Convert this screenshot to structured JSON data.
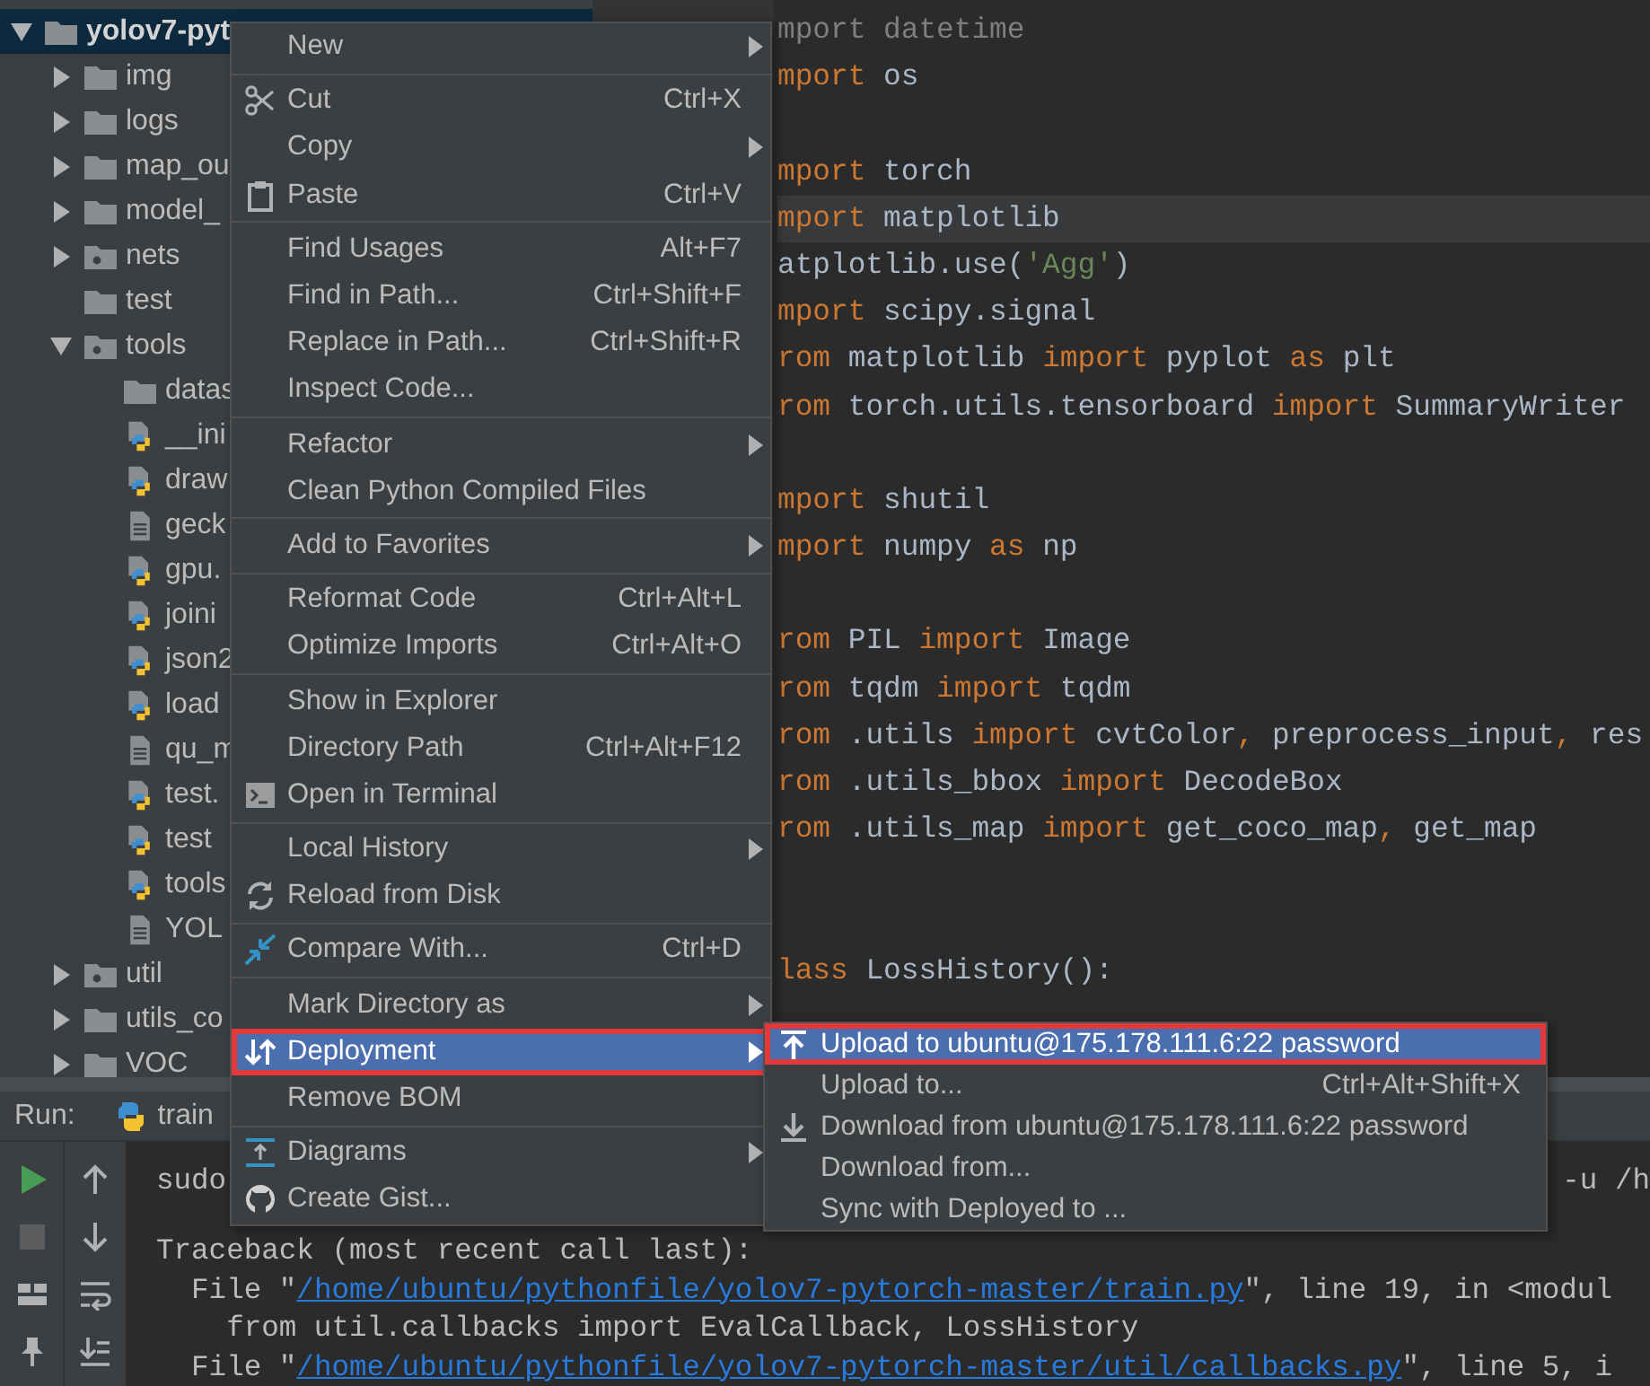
{
  "project_tree": {
    "nodes": [
      {
        "label": "yolov7-pyt",
        "kind": "folder",
        "expanded": true,
        "selected": true,
        "children": [
          {
            "label": "img",
            "kind": "folder",
            "expanded": false,
            "selected": false
          },
          {
            "label": "logs",
            "kind": "folder",
            "expanded": false,
            "selected": false
          },
          {
            "label": "map_ou",
            "kind": "folder",
            "expanded": false,
            "selected": false
          },
          {
            "label": "model_",
            "kind": "folder",
            "expanded": false,
            "selected": false
          },
          {
            "label": "nets",
            "kind": "package",
            "expanded": false,
            "selected": false
          },
          {
            "label": "test",
            "kind": "folder",
            "selected": false
          },
          {
            "label": "tools",
            "kind": "package",
            "expanded": true,
            "selected": false,
            "children": [
              {
                "label": "datas",
                "kind": "folder",
                "selected": false
              },
              {
                "label": "__ini",
                "kind": "python",
                "selected": false
              },
              {
                "label": "draw",
                "kind": "python",
                "selected": false
              },
              {
                "label": "geck",
                "kind": "text",
                "selected": false
              },
              {
                "label": "gpu.",
                "kind": "python",
                "selected": false
              },
              {
                "label": "joini",
                "kind": "python",
                "selected": false
              },
              {
                "label": "json2",
                "kind": "python",
                "selected": false
              },
              {
                "label": "load",
                "kind": "python",
                "selected": false
              },
              {
                "label": "qu_m",
                "kind": "text",
                "selected": false
              },
              {
                "label": "test.",
                "kind": "python",
                "selected": false
              },
              {
                "label": "test",
                "kind": "python",
                "selected": false
              },
              {
                "label": "tools",
                "kind": "python",
                "selected": false
              },
              {
                "label": "YOL",
                "kind": "text",
                "selected": false
              }
            ]
          },
          {
            "label": "util",
            "kind": "package",
            "expanded": false,
            "selected": false
          },
          {
            "label": "utils_co",
            "kind": "folder",
            "expanded": false,
            "selected": false
          },
          {
            "label": "VOC",
            "kind": "folder",
            "expanded": false,
            "selected": false
          }
        ]
      }
    ]
  },
  "editor": {
    "lines": [
      {
        "current": false,
        "tokens": [
          {
            "text": "mport datetime",
            "kind": "unused"
          }
        ]
      },
      {
        "current": false,
        "tokens": [
          {
            "text": "mport",
            "kind": "keyword"
          },
          {
            "text": " os",
            "kind": "plain"
          }
        ]
      },
      {
        "current": false
      },
      {
        "current": false,
        "tokens": [
          {
            "text": "mport",
            "kind": "keyword"
          },
          {
            "text": " torch",
            "kind": "plain"
          }
        ]
      },
      {
        "current": true,
        "tokens": [
          {
            "text": "mport",
            "kind": "keyword"
          },
          {
            "text": " matplotlib",
            "kind": "plain"
          }
        ]
      },
      {
        "current": false,
        "tokens": [
          {
            "text": "atplotlib.use(",
            "kind": "plain"
          },
          {
            "text": "'Agg'",
            "kind": "string"
          },
          {
            "text": ")",
            "kind": "plain"
          }
        ]
      },
      {
        "current": false,
        "tokens": [
          {
            "text": "mport",
            "kind": "keyword"
          },
          {
            "text": " scipy.signal",
            "kind": "plain"
          }
        ]
      },
      {
        "current": false,
        "tokens": [
          {
            "text": "rom",
            "kind": "keyword"
          },
          {
            "text": " matplotlib ",
            "kind": "plain"
          },
          {
            "text": "import",
            "kind": "keyword"
          },
          {
            "text": " pyplot ",
            "kind": "plain"
          },
          {
            "text": "as",
            "kind": "keyword"
          },
          {
            "text": " plt",
            "kind": "plain"
          }
        ]
      },
      {
        "current": false,
        "tokens": [
          {
            "text": "rom",
            "kind": "keyword"
          },
          {
            "text": " torch.utils.tensorboard ",
            "kind": "plain"
          },
          {
            "text": "import",
            "kind": "keyword"
          },
          {
            "text": " SummaryWriter",
            "kind": "plain"
          }
        ]
      },
      {
        "current": false
      },
      {
        "current": false,
        "tokens": [
          {
            "text": "mport",
            "kind": "keyword"
          },
          {
            "text": " shutil",
            "kind": "plain"
          }
        ]
      },
      {
        "current": false,
        "tokens": [
          {
            "text": "mport",
            "kind": "keyword"
          },
          {
            "text": " numpy ",
            "kind": "plain"
          },
          {
            "text": "as",
            "kind": "keyword"
          },
          {
            "text": " np",
            "kind": "plain"
          }
        ]
      },
      {
        "current": false
      },
      {
        "current": false,
        "tokens": [
          {
            "text": "rom",
            "kind": "keyword"
          },
          {
            "text": " PIL ",
            "kind": "plain"
          },
          {
            "text": "import",
            "kind": "keyword"
          },
          {
            "text": " Image",
            "kind": "plain"
          }
        ]
      },
      {
        "current": false,
        "tokens": [
          {
            "text": "rom",
            "kind": "keyword"
          },
          {
            "text": " tqdm ",
            "kind": "plain"
          },
          {
            "text": "import",
            "kind": "keyword"
          },
          {
            "text": " tqdm",
            "kind": "plain"
          }
        ]
      },
      {
        "current": false,
        "tokens": [
          {
            "text": "rom",
            "kind": "keyword"
          },
          {
            "text": " .utils ",
            "kind": "plain"
          },
          {
            "text": "import",
            "kind": "keyword"
          },
          {
            "text": " cvtColor",
            "kind": "plain"
          },
          {
            "text": ",",
            "kind": "keyword"
          },
          {
            "text": " preprocess_input",
            "kind": "plain"
          },
          {
            "text": ",",
            "kind": "keyword"
          },
          {
            "text": " res",
            "kind": "plain"
          }
        ]
      },
      {
        "current": false,
        "tokens": [
          {
            "text": "rom",
            "kind": "keyword"
          },
          {
            "text": " .utils_bbox ",
            "kind": "plain"
          },
          {
            "text": "import",
            "kind": "keyword"
          },
          {
            "text": " DecodeBox",
            "kind": "plain"
          }
        ]
      },
      {
        "current": false,
        "tokens": [
          {
            "text": "rom",
            "kind": "keyword"
          },
          {
            "text": " .utils_map ",
            "kind": "plain"
          },
          {
            "text": "import",
            "kind": "keyword"
          },
          {
            "text": " get_coco_map",
            "kind": "plain"
          },
          {
            "text": ",",
            "kind": "keyword"
          },
          {
            "text": " get_map",
            "kind": "plain"
          }
        ]
      },
      {
        "current": false
      },
      {
        "current": false
      },
      {
        "current": false,
        "tokens": [
          {
            "text": "lass",
            "kind": "keyword"
          },
          {
            "text": " LossHistory():",
            "kind": "plain"
          }
        ]
      }
    ]
  },
  "run_panel": {
    "label": "Run:",
    "tabs": [
      {
        "label": "train"
      }
    ],
    "console": [
      {
        "segments": [
          {
            "text": "sudo",
            "kind": "plain"
          },
          {
            "text": "-u /h",
            "kind": "right"
          }
        ]
      },
      {
        "segments": [
          {
            "text": "Traceback (most recent call last):",
            "kind": "plain"
          }
        ]
      },
      {
        "segments": [
          {
            "text": "  File \"",
            "kind": "plain"
          },
          {
            "text": "/home/ubuntu/pythonfile/yolov7-pytorch-master/train.py",
            "kind": "link"
          },
          {
            "text": "\", line 19, in <modul",
            "kind": "plain"
          }
        ]
      },
      {
        "segments": [
          {
            "text": "    from util.callbacks import EvalCallback, LossHistory",
            "kind": "plain"
          }
        ]
      },
      {
        "segments": [
          {
            "text": "  File \"",
            "kind": "plain"
          },
          {
            "text": "/home/ubuntu/pythonfile/yolov7-pytorch-master/util/callbacks.py",
            "kind": "link"
          },
          {
            "text": "\", line 5, i",
            "kind": "plain"
          }
        ]
      }
    ]
  },
  "context_menu": {
    "groups": [
      {
        "items": [
          {
            "label": "New",
            "submenu": true,
            "selected": false,
            "annotated": false
          }
        ]
      },
      {
        "items": [
          {
            "label": "Cut",
            "shortcut": "Ctrl+X",
            "kind": "cut",
            "submenu": false,
            "selected": false,
            "annotated": false
          },
          {
            "label": "Copy",
            "submenu": true,
            "selected": false,
            "annotated": false
          },
          {
            "label": "Paste",
            "shortcut": "Ctrl+V",
            "kind": "paste",
            "submenu": false,
            "selected": false,
            "annotated": false
          }
        ]
      },
      {
        "items": [
          {
            "label": "Find Usages",
            "shortcut": "Alt+F7",
            "submenu": false,
            "selected": false,
            "annotated": false
          },
          {
            "label": "Find in Path...",
            "shortcut": "Ctrl+Shift+F",
            "submenu": false,
            "selected": false,
            "annotated": false
          },
          {
            "label": "Replace in Path...",
            "shortcut": "Ctrl+Shift+R",
            "submenu": false,
            "selected": false,
            "annotated": false
          },
          {
            "label": "Inspect Code...",
            "submenu": false,
            "selected": false,
            "annotated": false
          }
        ]
      },
      {
        "items": [
          {
            "label": "Refactor",
            "submenu": true,
            "selected": false,
            "annotated": false
          },
          {
            "label": "Clean Python Compiled Files",
            "submenu": false,
            "selected": false,
            "annotated": false
          }
        ]
      },
      {
        "items": [
          {
            "label": "Add to Favorites",
            "submenu": true,
            "selected": false,
            "annotated": false
          }
        ]
      },
      {
        "items": [
          {
            "label": "Reformat Code",
            "shortcut": "Ctrl+Alt+L",
            "submenu": false,
            "selected": false,
            "annotated": false
          },
          {
            "label": "Optimize Imports",
            "shortcut": "Ctrl+Alt+O",
            "submenu": false,
            "selected": false,
            "annotated": false
          }
        ]
      },
      {
        "items": [
          {
            "label": "Show in Explorer",
            "submenu": false,
            "selected": false,
            "annotated": false
          },
          {
            "label": "Directory Path",
            "shortcut": "Ctrl+Alt+F12",
            "submenu": false,
            "selected": false,
            "annotated": false
          },
          {
            "label": "Open in Terminal",
            "kind": "terminal",
            "submenu": false,
            "selected": false,
            "annotated": false
          }
        ]
      },
      {
        "items": [
          {
            "label": "Local History",
            "submenu": true,
            "selected": false,
            "annotated": false
          },
          {
            "label": "Reload from Disk",
            "kind": "reload",
            "submenu": false,
            "selected": false,
            "annotated": false
          }
        ]
      },
      {
        "items": [
          {
            "label": "Compare With...",
            "shortcut": "Ctrl+D",
            "kind": "compare",
            "submenu": false,
            "selected": false,
            "annotated": false
          }
        ]
      },
      {
        "items": [
          {
            "label": "Mark Directory as",
            "submenu": true,
            "selected": false,
            "annotated": false
          },
          {
            "label": "Deployment",
            "kind": "deploy",
            "submenu": true,
            "selected": true,
            "annotated": true
          },
          {
            "label": "Remove BOM",
            "submenu": false,
            "selected": false,
            "annotated": false
          }
        ]
      },
      {
        "items": [
          {
            "label": "Diagrams",
            "kind": "diagram",
            "submenu": true,
            "selected": false,
            "annotated": false
          },
          {
            "label": "Create Gist...",
            "kind": "gist",
            "submenu": false,
            "selected": false,
            "annotated": false
          }
        ]
      }
    ]
  },
  "deployment_submenu": {
    "items": [
      {
        "label": "Upload to ubuntu@175.178.111.6:22 password",
        "kind": "upload",
        "selected": true,
        "annotated": true
      },
      {
        "label": "Upload to...",
        "shortcut": "Ctrl+Alt+Shift+X",
        "selected": false,
        "annotated": false
      },
      {
        "label": "Download from ubuntu@175.178.111.6:22 password",
        "kind": "download",
        "selected": false,
        "annotated": false
      },
      {
        "label": "Download from...",
        "selected": false,
        "annotated": false
      },
      {
        "label": "Sync with Deployed to ...",
        "selected": false,
        "annotated": false
      }
    ]
  }
}
